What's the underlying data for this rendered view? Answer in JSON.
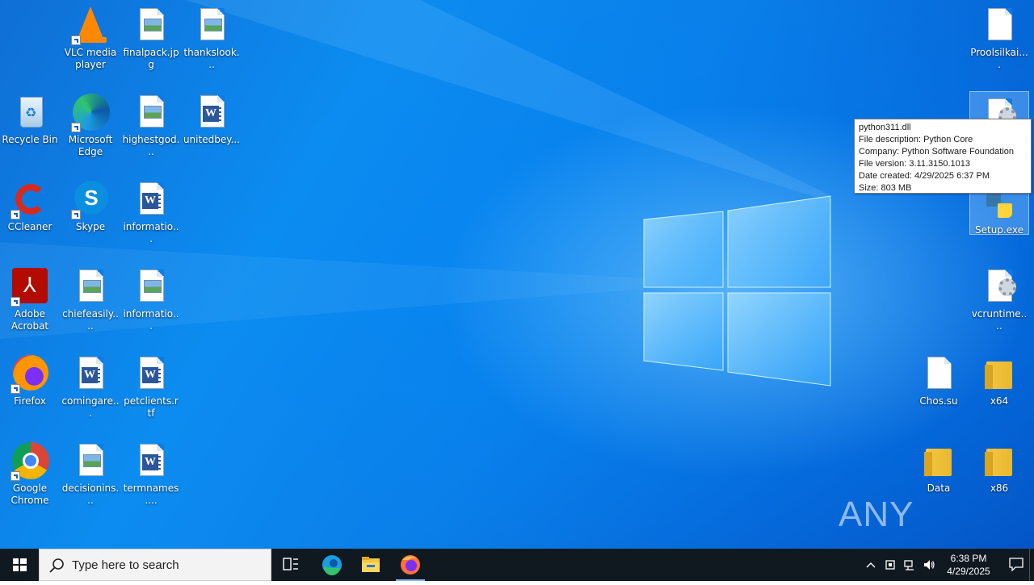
{
  "desktop": {
    "icons": [
      {
        "label": "VLC media player",
        "icon": "vlc-icon"
      },
      {
        "label": "finalpack.jpg",
        "icon": "image-file-icon"
      },
      {
        "label": "thankslook...",
        "icon": "image-file-icon"
      },
      {
        "label": "Recycle Bin",
        "icon": "recycle-bin-icon"
      },
      {
        "label": "Microsoft Edge",
        "icon": "edge-icon"
      },
      {
        "label": "highestgod...",
        "icon": "image-file-icon"
      },
      {
        "label": "unitedbey...",
        "icon": "word-file-icon"
      },
      {
        "label": "CCleaner",
        "icon": "ccleaner-icon"
      },
      {
        "label": "Skype",
        "icon": "skype-icon"
      },
      {
        "label": "informatio...",
        "icon": "word-file-icon"
      },
      {
        "label": "Adobe Acrobat",
        "icon": "acrobat-icon"
      },
      {
        "label": "chiefeasily....",
        "icon": "image-file-icon"
      },
      {
        "label": "informatio...",
        "icon": "image-file-icon"
      },
      {
        "label": "Firefox",
        "icon": "firefox-icon"
      },
      {
        "label": "comingare...",
        "icon": "word-file-icon"
      },
      {
        "label": "petclients.rtf",
        "icon": "word-file-icon"
      },
      {
        "label": "Google Chrome",
        "icon": "chrome-icon"
      },
      {
        "label": "decisionins...",
        "icon": "image-file-icon"
      },
      {
        "label": "termnames....",
        "icon": "word-file-icon"
      },
      {
        "label": "Proolsilkai....",
        "icon": "blank-file-icon"
      },
      {
        "label": "Setup.exe",
        "icon": "python-icon"
      },
      {
        "label": "vcruntime....",
        "icon": "settings-file-icon"
      },
      {
        "label": "Chos.su",
        "icon": "blank-file-icon"
      },
      {
        "label": "x64",
        "icon": "folder-icon"
      },
      {
        "label": "Data",
        "icon": "folder-icon"
      },
      {
        "label": "x86",
        "icon": "folder-icon"
      }
    ],
    "tooltip": {
      "line1": "python311.dll",
      "line2": "File description: Python Core",
      "line3": "Company: Python Software Foundation",
      "line4": "File version: 3.11.3150.1013",
      "line5": "Date created: 4/29/2025 6:37 PM",
      "line6": "Size: 803 MB"
    },
    "watermark": "ANY RUN"
  },
  "taskbar": {
    "search_placeholder": "Type here to search",
    "time": "6:38 PM",
    "date": "4/29/2025",
    "apps": [
      "task-view-icon",
      "edge-icon",
      "file-explorer-icon",
      "firefox-icon"
    ]
  }
}
